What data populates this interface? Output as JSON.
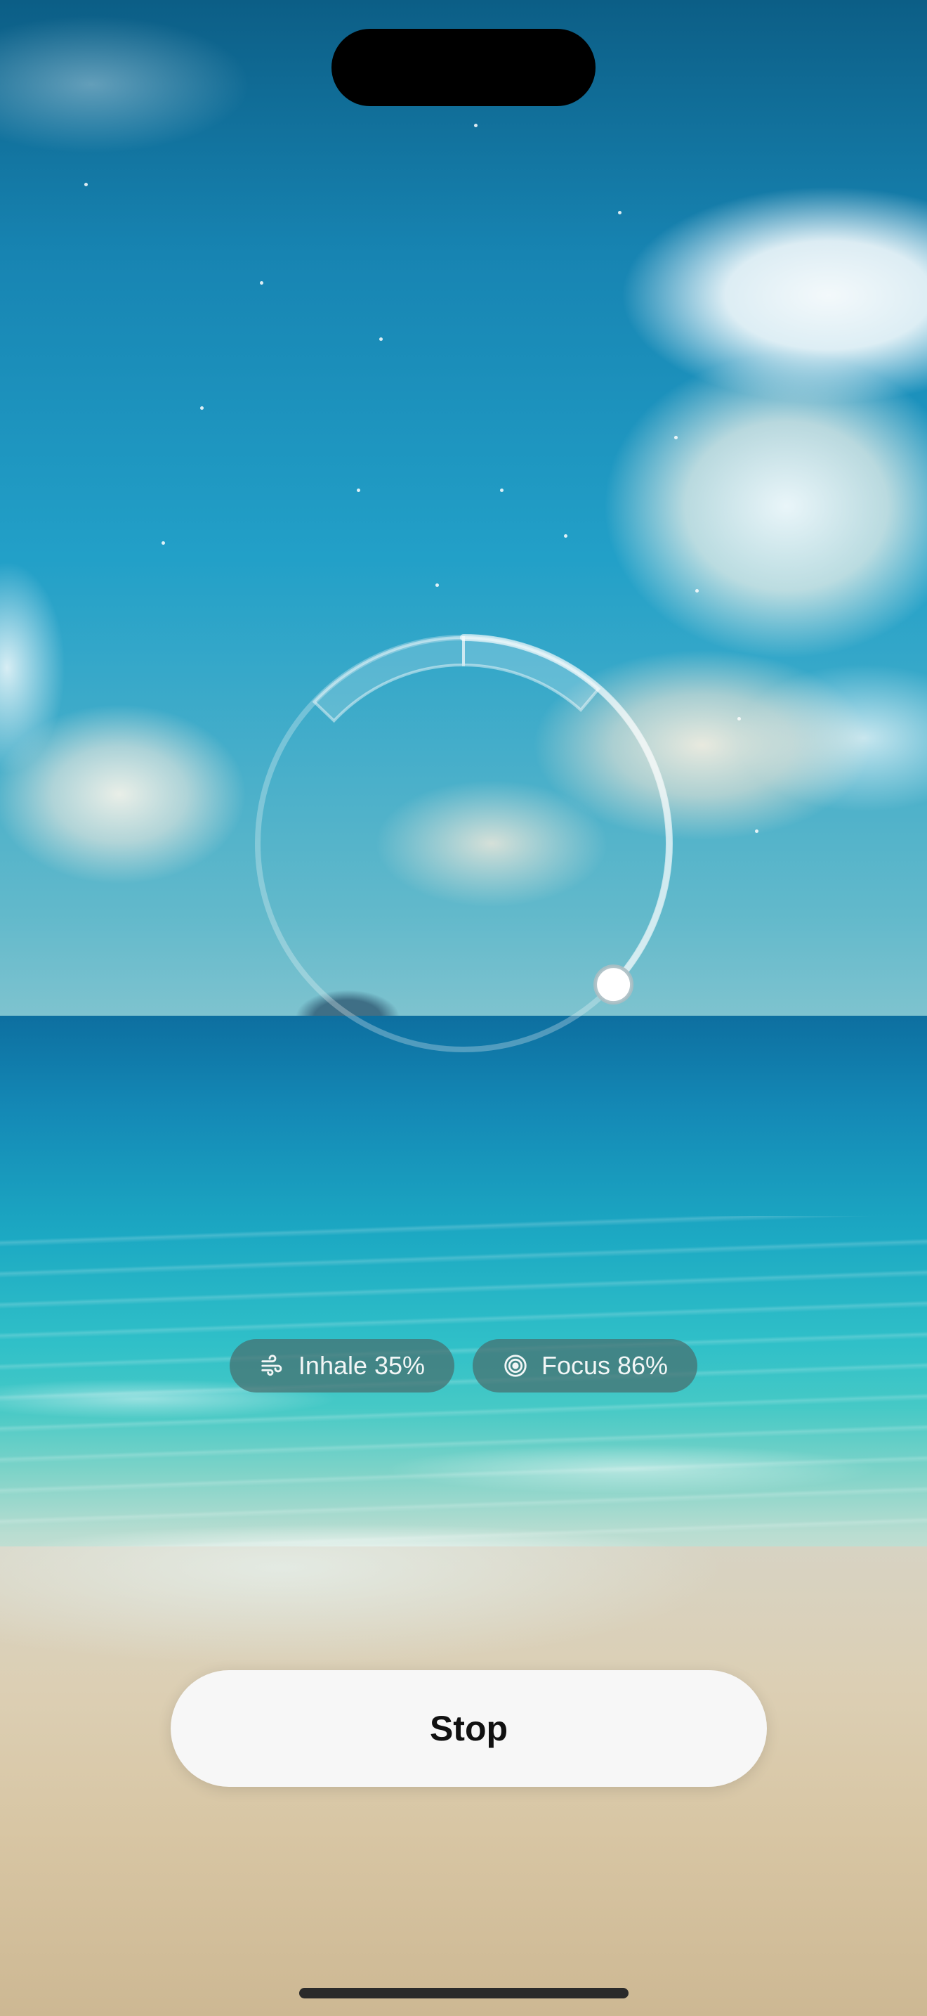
{
  "breathing": {
    "progress_fraction": 0.37
  },
  "stats": {
    "inhale": {
      "icon": "wind-icon",
      "label": "Inhale 35%"
    },
    "focus": {
      "icon": "target-icon",
      "label": "Focus 86%"
    }
  },
  "actions": {
    "stop_label": "Stop"
  },
  "colors": {
    "pill_background": "#466e6e",
    "button_background": "#f7f7f7",
    "button_text": "#111111"
  }
}
